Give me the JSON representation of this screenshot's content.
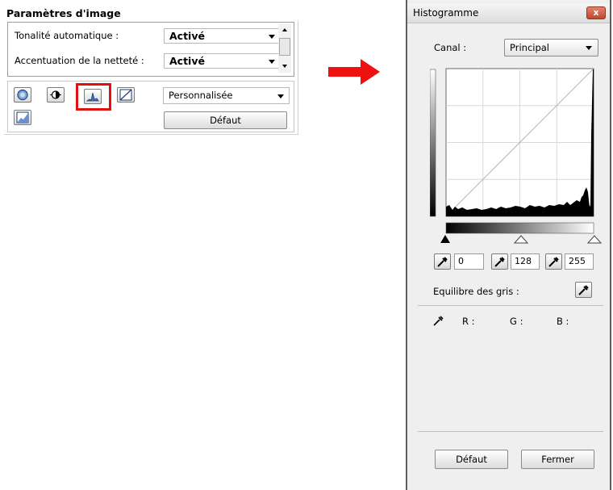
{
  "left_panel": {
    "title": "Paramètres d'image",
    "auto_tone_label": "Tonalité automatique :",
    "auto_tone_value": "Activé",
    "sharpen_label": "Accentuation de la netteté :",
    "sharpen_value": "Activé",
    "preset_value": "Personnalisée",
    "default_button": "Défaut",
    "tools": [
      "brightness-contrast-icon",
      "exposure-icon",
      "histogram-icon",
      "tone-curve-icon",
      "final-review-icon"
    ]
  },
  "dialog": {
    "title": "Histogramme",
    "close_glyph": "x",
    "channel_label": "Canal :",
    "channel_value": "Principal",
    "black_point": "0",
    "mid_point": "128",
    "white_point": "255",
    "gray_balance_label": "Equilibre des gris :",
    "r_label": "R :",
    "g_label": "G :",
    "b_label": "B :",
    "default_button": "Défaut",
    "close_button": "Fermer"
  },
  "colors": {
    "highlight": "#e01010",
    "arrow": "#ee1111",
    "dialog_background": "#efefef",
    "close_button": "#c1462e"
  }
}
